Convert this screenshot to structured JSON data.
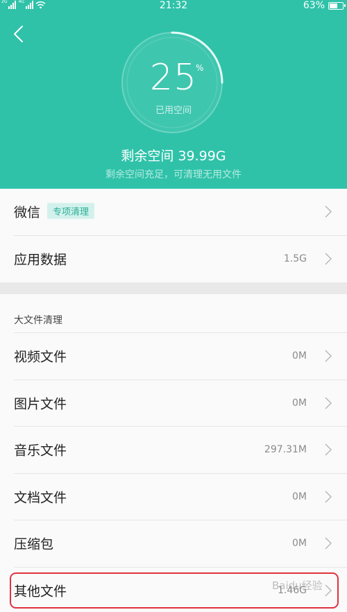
{
  "status_bar": {
    "sim1_tag": "2G",
    "sim2_tag": "4G",
    "time": "21:32",
    "battery": "63%",
    "battery_level": 0.63
  },
  "header": {
    "used_percent": "25",
    "used_percent_value": 0.25,
    "percent_sign": "%",
    "used_label": "已用空间",
    "remaining": "剩余空间 39.99G",
    "hint": "剩余空间充足，可清理无用文件"
  },
  "top_items": [
    {
      "label": "微信",
      "badge": "专项清理",
      "value": ""
    },
    {
      "label": "应用数据",
      "value": "1.5G"
    }
  ],
  "large_files": {
    "title": "大文件清理",
    "items": [
      {
        "label": "视频文件",
        "value": "0M"
      },
      {
        "label": "图片文件",
        "value": "0M"
      },
      {
        "label": "音乐文件",
        "value": "297.31M"
      },
      {
        "label": "文档文件",
        "value": "0M"
      },
      {
        "label": "压缩包",
        "value": "0M"
      },
      {
        "label": "其他文件",
        "value": "1.46G"
      }
    ]
  },
  "watermark": "Baidu经验",
  "colors": {
    "header_bg": "#2fc2a9",
    "badge_bg": "#d3f1ec",
    "badge_text": "#2aae97",
    "highlight": "#e0323e"
  }
}
